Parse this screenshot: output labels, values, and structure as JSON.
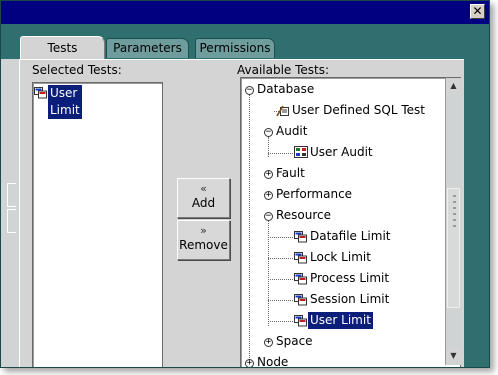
{
  "window": {
    "close_glyph": "✕"
  },
  "tabs": [
    {
      "label": "Tests",
      "active": true
    },
    {
      "label": "Parameters",
      "active": false
    },
    {
      "label": "Permissions",
      "active": false
    }
  ],
  "selected": {
    "label": "Selected Tests:",
    "items": [
      {
        "label": "User Limit",
        "icon": "test-icon",
        "selected": true
      }
    ]
  },
  "buttons": {
    "add": {
      "arrow": "«",
      "label": "Add"
    },
    "remove": {
      "arrow": "»",
      "label": "Remove"
    }
  },
  "available": {
    "label": "Available Tests:",
    "tree": [
      {
        "label": "Database",
        "expander": "minus",
        "icon": ""
      },
      {
        "label": "User Defined SQL Test",
        "icon": "sql-test-icon"
      },
      {
        "label": "Audit",
        "expander": "minus"
      },
      {
        "label": "User Audit",
        "icon": "audit-icon"
      },
      {
        "label": "Fault",
        "expander": "plus"
      },
      {
        "label": "Performance",
        "expander": "plus"
      },
      {
        "label": "Resource",
        "expander": "minus"
      },
      {
        "label": "Datafile Limit",
        "icon": "test-icon"
      },
      {
        "label": "Lock Limit",
        "icon": "test-icon"
      },
      {
        "label": "Process Limit",
        "icon": "test-icon"
      },
      {
        "label": "Session Limit",
        "icon": "test-icon"
      },
      {
        "label": "User Limit",
        "icon": "test-icon",
        "selected": true
      },
      {
        "label": "Space",
        "expander": "plus"
      },
      {
        "label": "Node",
        "expander": "plus"
      }
    ]
  },
  "colors": {
    "selection": "#0a1e7a",
    "titlebar": "#000080",
    "window_bg": "#2f6f6f",
    "panel": "#d4d4d4"
  }
}
